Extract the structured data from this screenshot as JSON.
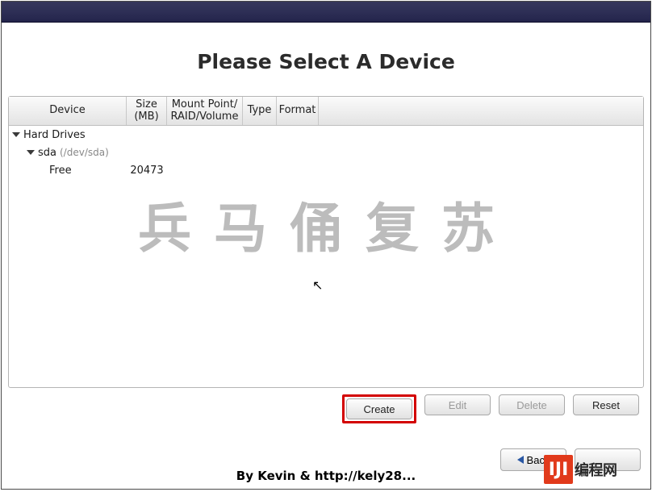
{
  "title": "Please Select A Device",
  "columns": {
    "device": "Device",
    "size": "Size\n(MB)",
    "mount": "Mount Point/\nRAID/Volume",
    "type": "Type",
    "format": "Format"
  },
  "tree": {
    "root_label": "Hard Drives",
    "disk": {
      "name": "sda",
      "path": "(/dev/sda)"
    },
    "free": {
      "label": "Free",
      "size": "20473"
    }
  },
  "watermark": "兵马俑复苏",
  "buttons": {
    "create": "Create",
    "edit": "Edit",
    "delete": "Delete",
    "reset": "Reset",
    "back": "Back"
  },
  "footer": "By Kevin & http://kely28...",
  "logo": {
    "square": "IJI",
    "text": "编程网"
  }
}
